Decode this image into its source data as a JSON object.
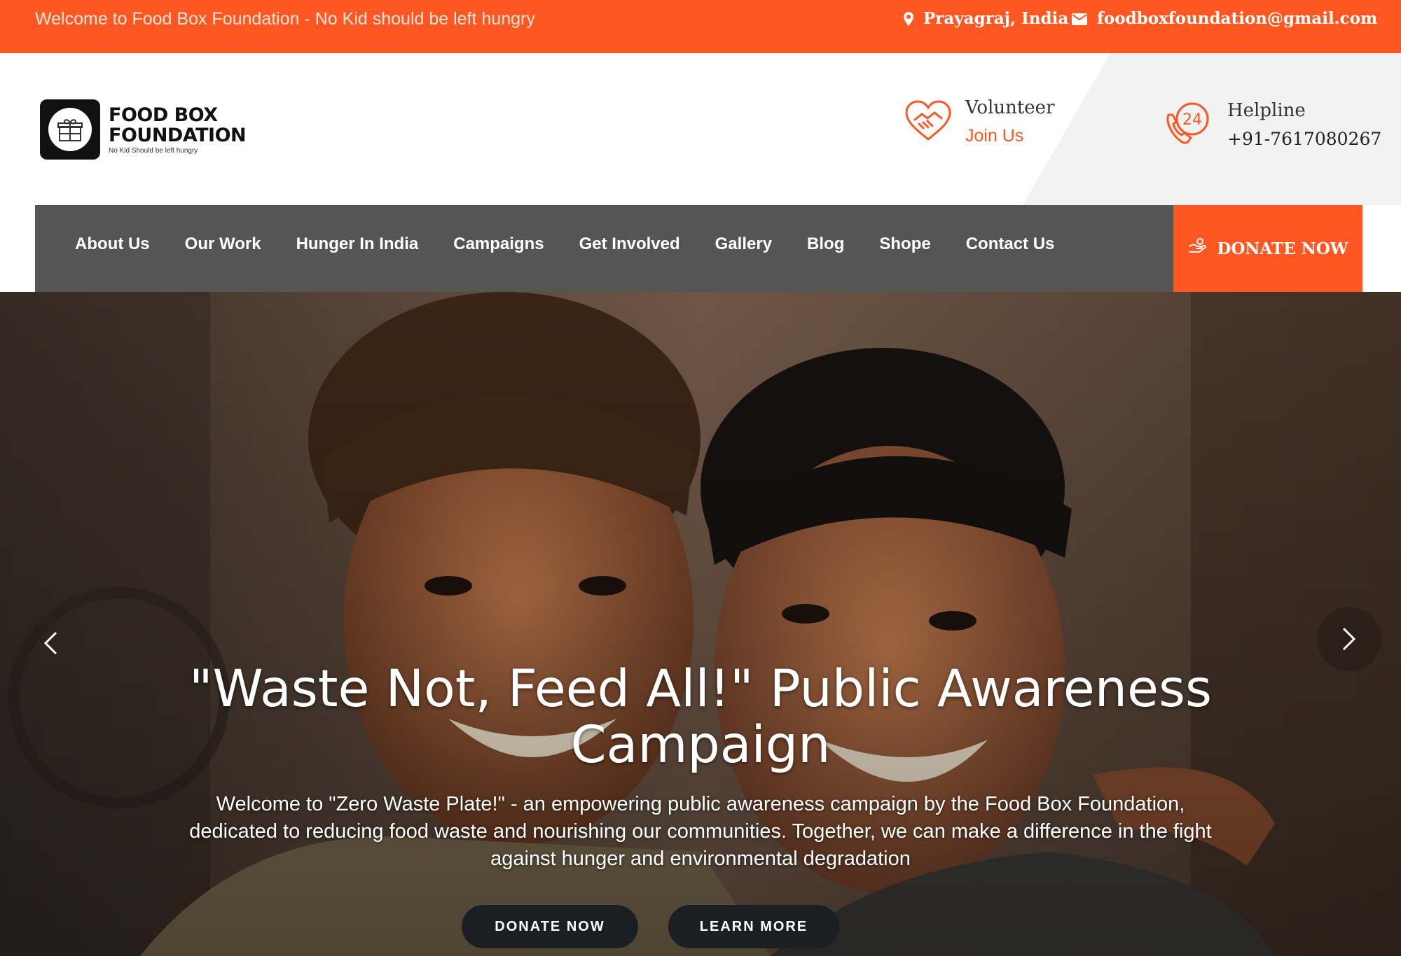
{
  "topbar": {
    "welcome": "Welcome to Food Box Foundation - No Kid should be left hungry",
    "location": "Prayagraj, India",
    "email": "foodboxfoundation@gmail.com",
    "location_icon": "map-pin-icon",
    "email_icon": "envelope-icon"
  },
  "logo": {
    "line1": "FOOD BOX",
    "line2": "FOUNDATION",
    "tagline": "No Kid Should be left hungry"
  },
  "volunteer": {
    "title": "Volunteer",
    "link": "Join Us",
    "icon": "handshake-heart-icon"
  },
  "helpline": {
    "title": "Helpline",
    "number": "+91-7617080267",
    "icon": "phone-24-icon"
  },
  "nav": {
    "items": [
      "About Us",
      "Our Work",
      "Hunger In India",
      "Campaigns",
      "Get Involved",
      "Gallery",
      "Blog",
      "Shope",
      "Contact Us"
    ],
    "donate": "DONATE NOW",
    "donate_icon": "donation-hand-icon"
  },
  "hero": {
    "title_line1": "\"Waste Not, Feed All!\" Public Awareness",
    "title_line2": "Campaign",
    "text_line1": "Welcome to \"Zero Waste Plate!\" - an empowering public awareness campaign by the Food Box Foundation,",
    "text_line2": "dedicated to reducing food waste and nourishing our communities. Together, we can make a difference in the fight",
    "text_line3": "against hunger and environmental degradation",
    "btn_donate": "DONATE NOW",
    "btn_learn": "LEARN MORE"
  },
  "colors": {
    "accent": "#ff5722",
    "nav_bg": "#555555",
    "button_dark": "#1b1e22"
  }
}
